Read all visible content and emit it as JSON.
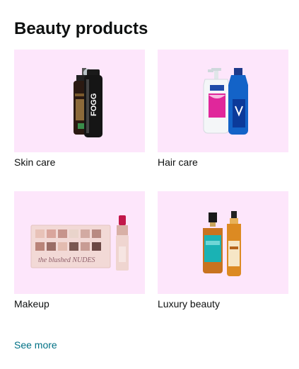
{
  "card": {
    "title": "Beauty products",
    "tiles": [
      {
        "label": "Skin care",
        "image_alt": "Foaming face wash and FOGG deodorant",
        "brand_text": "FOGG"
      },
      {
        "label": "Hair care",
        "image_alt": "Shampoo bottle and hair oil bottle"
      },
      {
        "label": "Makeup",
        "image_alt": "Eyeshadow palette and lipstick",
        "palette_text": "the blushed NUDES"
      },
      {
        "label": "Luxury beauty",
        "image_alt": "Two hair oil bottles"
      }
    ],
    "see_more": "See more"
  }
}
